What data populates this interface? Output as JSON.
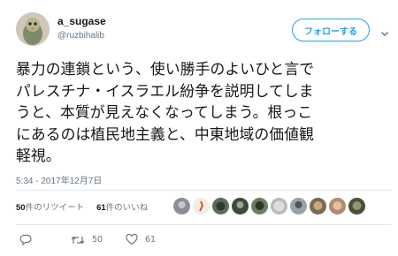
{
  "user": {
    "display_name": "a_sugase",
    "handle": "@ruzbihalib"
  },
  "follow_button": {
    "label": "フォローする"
  },
  "tweet": {
    "lines": [
      "暴力の連鎖という、使い勝手のよいひと言で",
      "パレスチナ・イスラエル紛争を説明してしま",
      "うと、本質が見えなくなってしまう。根っこ",
      "にあるのは植民地主義と、中東地域の価値観",
      "軽視。"
    ],
    "timestamp": "5:34 - 2017年12月7日"
  },
  "stats": {
    "retweets_count": "50",
    "retweets_label": "件のリツイート",
    "likes_count": "61",
    "likes_label": "件のいいね"
  },
  "actions": {
    "retweet_count": "50",
    "like_count": "61"
  },
  "colors": {
    "accent": "#1da1f2",
    "muted": "#657786",
    "text": "#14171a"
  },
  "icons": [
    "chevron-down-icon",
    "reply-icon",
    "retweet-icon",
    "heart-icon"
  ]
}
